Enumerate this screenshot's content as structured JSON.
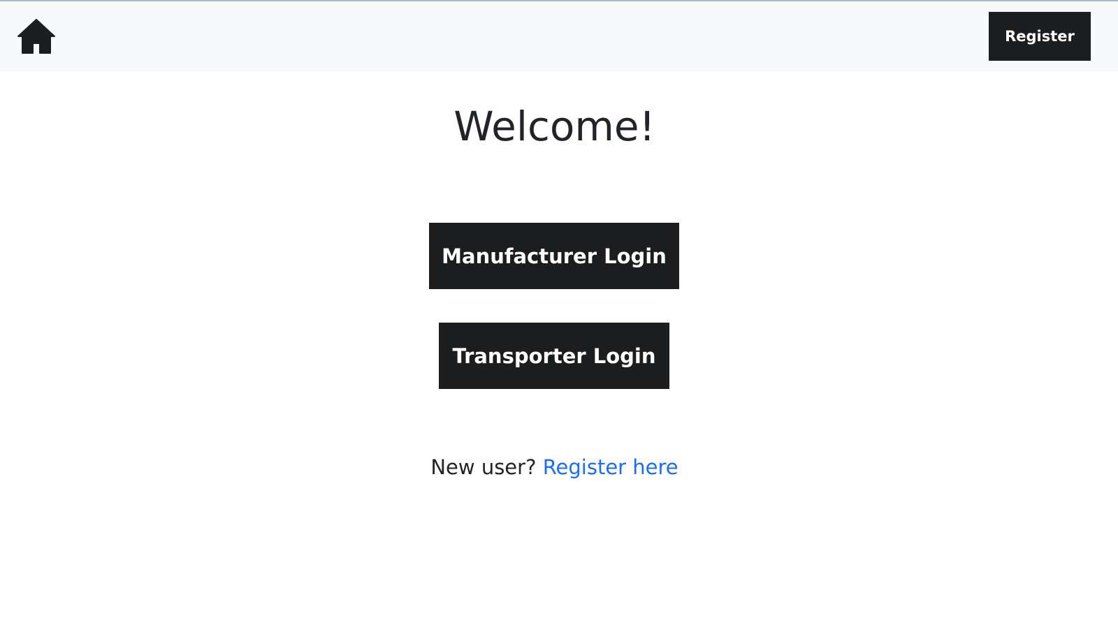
{
  "navbar": {
    "home_icon": "home-icon",
    "register_label": "Register"
  },
  "main": {
    "heading": "Welcome!",
    "manufacturer_login_label": "Manufacturer Login",
    "transporter_login_label": "Transporter Login",
    "new_user_prompt": "New user?",
    "register_link_label": "Register here"
  },
  "colors": {
    "navbar_bg": "#f8f9fa",
    "button_bg": "#1b1d1f",
    "button_text": "#ffffff",
    "link": "#1a6ef5",
    "text": "#212529"
  }
}
